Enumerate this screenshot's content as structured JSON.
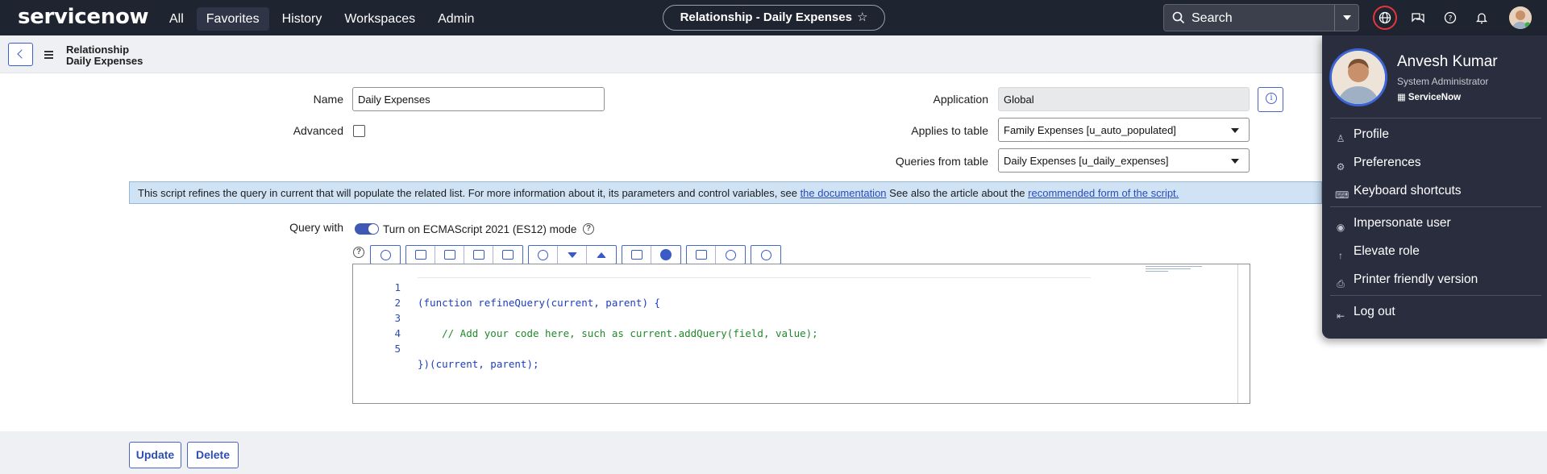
{
  "nav": {
    "logo": "servicenow",
    "items": [
      "All",
      "Favorites",
      "History",
      "Workspaces",
      "Admin"
    ],
    "title_pill": "Relationship - Daily Expenses",
    "search_placeholder": "Search"
  },
  "breadcrumb": {
    "line1": "Relationship",
    "line2": "Daily Expenses"
  },
  "form": {
    "name_label": "Name",
    "name_value": "Daily Expenses",
    "advanced_label": "Advanced",
    "application_label": "Application",
    "application_value": "Global",
    "applies_label": "Applies to table",
    "applies_value": "Family Expenses [u_auto_populated]",
    "queries_label": "Queries from table",
    "queries_value": "Daily Expenses [u_daily_expenses]",
    "banner_text": "This script refines the query in current that will populate the related list. For more information about it, its parameters and control variables, see ",
    "banner_link1": "the documentation",
    "banner_mid": " See also the article about the ",
    "banner_link2": "recommended form of the script.",
    "query_with_label": "Query with",
    "toggle_label": "Turn on ECMAScript 2021 (ES12) mode"
  },
  "editor": {
    "lines": [
      {
        "num": "1",
        "text": "(function refineQuery(current, parent) {"
      },
      {
        "num": "2",
        "text": ""
      },
      {
        "num": "3",
        "text": "    // Add your code here, such as current.addQuery(field, value);"
      },
      {
        "num": "4",
        "text": ""
      },
      {
        "num": "5",
        "text": "})(current, parent);"
      }
    ]
  },
  "footer": {
    "update_label": "Update",
    "delete_label": "Delete"
  },
  "profile": {
    "name": "Anvesh Kumar",
    "role": "System Administrator",
    "instance": "ServiceNow",
    "items": [
      {
        "label": "Profile",
        "icon": "person-icon"
      },
      {
        "label": "Preferences",
        "icon": "gear-icon"
      },
      {
        "label": "Keyboard shortcuts",
        "icon": "keyboard-icon"
      },
      {
        "label": "Impersonate user",
        "icon": "eye-icon"
      },
      {
        "label": "Elevate role",
        "icon": "arrow-up-icon"
      },
      {
        "label": "Printer friendly version",
        "icon": "printer-icon"
      },
      {
        "label": "Log out",
        "icon": "logout-icon"
      }
    ]
  },
  "colors": {
    "nav_bg": "#1f2431",
    "accent": "#3f58b5",
    "banner_bg": "#cfe3f5",
    "alert_red": "#e8343a"
  }
}
